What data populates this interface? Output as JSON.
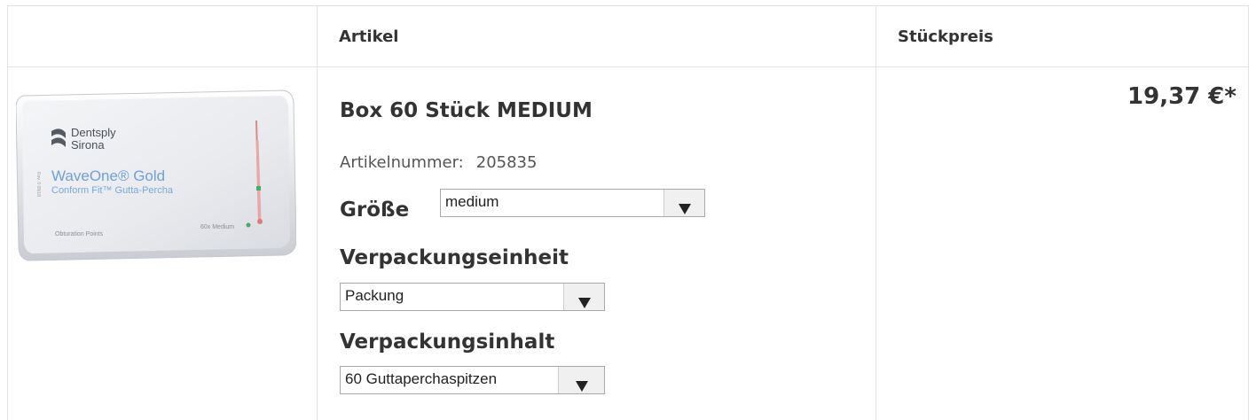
{
  "table": {
    "columns": [
      "",
      "Artikel",
      "Stückpreis"
    ]
  },
  "product": {
    "image": {
      "brand_line1": "Dentsply",
      "brand_line2": "Sirona",
      "product_line1": "WaveOne® Gold",
      "product_line2": "Conform Fit™ Gutta-Percha",
      "footer_left": "Obturation Points",
      "footer_right": "60x Medium",
      "side_text": "Rev. 0 08/18"
    },
    "title": "Box 60 Stück MEDIUM",
    "article_number_label": "Artikelnummer:",
    "article_number": "205835",
    "options": [
      {
        "label": "Größe",
        "selected": "medium"
      },
      {
        "label": "Verpackungseinheit",
        "selected": "Packung"
      },
      {
        "label": "Verpackungsinhalt",
        "selected": "60 Guttaperchaspitzen"
      }
    ],
    "price": "19,37 €*"
  },
  "colors": {
    "border": "#e3e3e3",
    "text": "#333333",
    "point_pink": "#e07d7d",
    "point_green": "#3fae6a"
  }
}
